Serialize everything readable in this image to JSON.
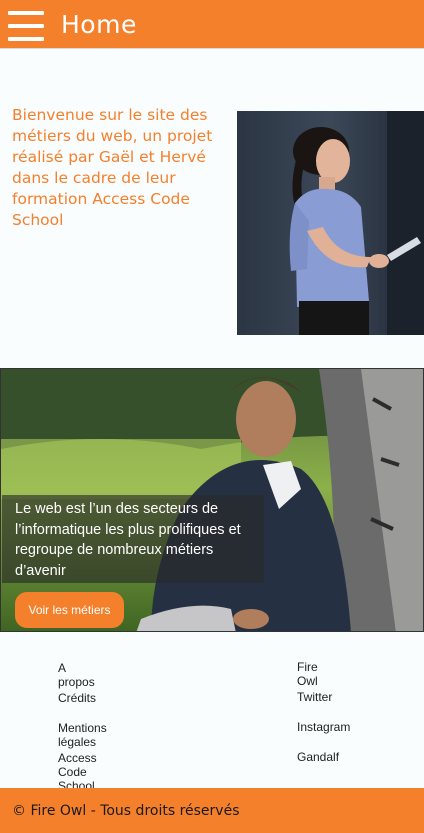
{
  "header": {
    "title": "Home",
    "menu_icon": "hamburger-menu-icon"
  },
  "intro": {
    "text": "Bienvenue sur le site des métiers du web, un projet réalisé par Gaël et Hervé dans le cadre de leur formation Access Code School"
  },
  "hero": {
    "caption": "Le web est l’un des secteurs de l’informatique les plus prolifiques et regroupe de nombreux métiers d’avenir",
    "button_label": "Voir les métiers"
  },
  "footer": {
    "left_links": [
      "A propos",
      "Crédits",
      "Mentions légales",
      "Access Code School"
    ],
    "right_links": [
      "Fire Owl",
      "Twitter",
      "Instagram",
      "Gandalf"
    ],
    "copyright": "©  Fire Owl - Tous droits réservés"
  },
  "colors": {
    "accent": "#f5802c",
    "background": "#f9fdfe"
  }
}
